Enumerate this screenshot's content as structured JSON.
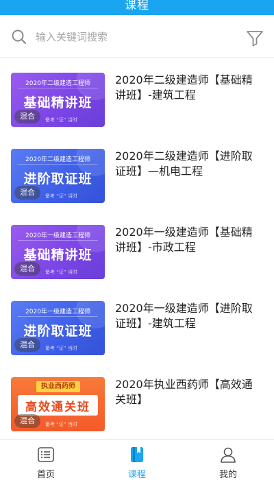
{
  "header": {
    "title": "课程"
  },
  "search": {
    "placeholder": "输入关键词搜索",
    "search_icon": "search-icon",
    "filter_icon": "filter-icon"
  },
  "courses": [
    {
      "thumb_top": "2020年二级建造工程师",
      "thumb_main": "基础精讲班",
      "thumb_slogan": "备考 “证” 当时",
      "badge": "混合",
      "title": "2020年二级建造师【基础精讲班】-建筑工程",
      "theme": "purple"
    },
    {
      "thumb_top": "2020年二级建造工程师",
      "thumb_main": "进阶取证班",
      "thumb_slogan": "备考 “证” 当时",
      "badge": "混合",
      "title": "2020年二级建造师【进阶取证班】—机电工程",
      "theme": "blue"
    },
    {
      "thumb_top": "2020年一级建造工程师",
      "thumb_main": "基础精讲班",
      "thumb_slogan": "备考 “证” 当时",
      "badge": "混合",
      "title": "2020年一级建造师【基础精讲班】-市政工程",
      "theme": "purple"
    },
    {
      "thumb_top": "2020年一级建造工程师",
      "thumb_main": "进阶取证班",
      "thumb_slogan": "备考 “证” 当时",
      "badge": "混合",
      "title": "2020年一级建造师【进阶取证班】-建筑工程",
      "theme": "blue"
    },
    {
      "thumb_top": "执业西药师",
      "thumb_main": "高效通关班",
      "thumb_slogan": "备考 “证” 当时",
      "badge": "混合",
      "title": "2020年执业西药师【高效通关班】",
      "theme": "orange"
    }
  ],
  "tabbar": {
    "items": [
      {
        "label": "首页",
        "icon": "home-list-icon"
      },
      {
        "label": "课程",
        "icon": "book-icon",
        "active": true
      },
      {
        "label": "我的",
        "icon": "user-icon"
      }
    ]
  },
  "colors": {
    "accent": "#1aa5f0",
    "purple": "#7a44e6",
    "blue": "#3d5ee8",
    "orange": "#f55a2a"
  }
}
